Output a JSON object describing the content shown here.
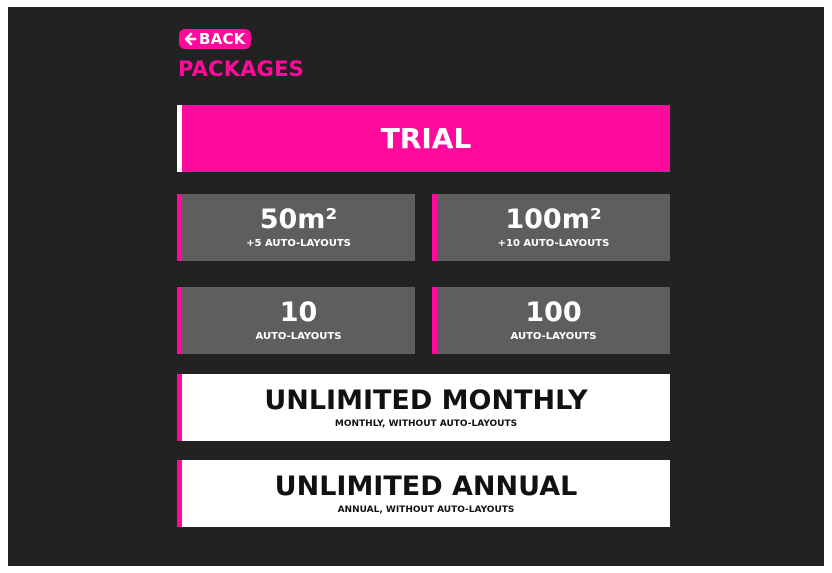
{
  "header": {
    "back_label": "BACK",
    "title": "PACKAGES"
  },
  "packages": {
    "trial": {
      "label": "TRIAL"
    },
    "area_50": {
      "label": "50m²",
      "sublabel": "+5 AUTO-LAYOUTS"
    },
    "area_100": {
      "label": "100m²",
      "sublabel": "+10 AUTO-LAYOUTS"
    },
    "layouts_10": {
      "label": "10",
      "sublabel": "AUTO-LAYOUTS"
    },
    "layouts_100": {
      "label": "100",
      "sublabel": "AUTO-LAYOUTS"
    },
    "unlimited_monthly": {
      "label": "UNLIMITED MONTHLY",
      "sublabel": "MONTHLY, WITHOUT AUTO-LAYOUTS"
    },
    "unlimited_annual": {
      "label": "UNLIMITED ANNUAL",
      "sublabel": "ANNUAL, WITHOUT AUTO-LAYOUTS"
    }
  },
  "colors": {
    "accent": "#ff0a9c",
    "background": "#222222",
    "card_grey": "#5e5e5e",
    "card_white": "#ffffff"
  },
  "icons": {
    "back": "back-arrow-icon"
  }
}
